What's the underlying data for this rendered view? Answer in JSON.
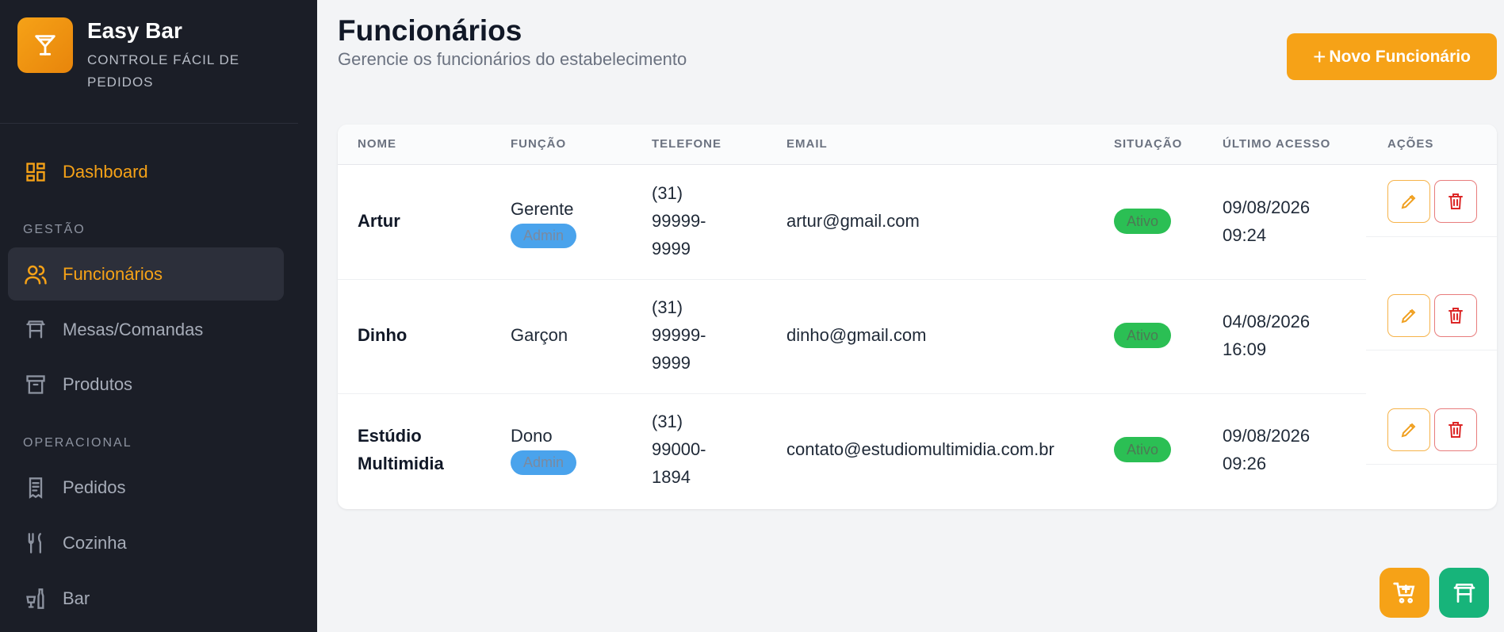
{
  "brand": {
    "title": "Easy Bar",
    "subtitle": "CONTROLE FÁCIL DE PEDIDOS"
  },
  "sidebar": {
    "dashboard": "Dashboard",
    "section_gestao": "GESTÃO",
    "funcionarios": "Funcionários",
    "mesas": "Mesas/Comandas",
    "produtos": "Produtos",
    "section_operacional": "OPERACIONAL",
    "pedidos": "Pedidos",
    "cozinha": "Cozinha",
    "bar": "Bar",
    "active_item": "Funcionários"
  },
  "header": {
    "title": "Funcionários",
    "subtitle": "Gerencie os funcionários do estabelecimento",
    "new_button": "Novo Funcionário"
  },
  "table": {
    "columns": [
      "NOME",
      "FUNÇÃO",
      "TELEFONE",
      "EMAIL",
      "SITUAÇÃO",
      "ÚLTIMO ACESSO",
      "AÇÕES"
    ],
    "rows": [
      {
        "name_l1": "Artur",
        "name_l2": "",
        "role": "Gerente",
        "badge": "Admin",
        "phone_l1": "(31)",
        "phone_l2": "99999-",
        "phone_l3": "9999",
        "email": "artur@gmail.com",
        "status": "Ativo",
        "date": "09/08/2026",
        "time": "09:24"
      },
      {
        "name_l1": "Dinho",
        "name_l2": "",
        "role": "Garçon",
        "badge": "",
        "phone_l1": "(31)",
        "phone_l2": "99999-",
        "phone_l3": "9999",
        "email": "dinho@gmail.com",
        "status": "Ativo",
        "date": "04/08/2026",
        "time": "16:09"
      },
      {
        "name_l1": "Estúdio",
        "name_l2": "Multimidia",
        "role": "Dono",
        "badge": "Admin",
        "phone_l1": "(31)",
        "phone_l2": "99000-",
        "phone_l3": "1894",
        "email": "contato@estudiomultimidia.com.br",
        "status": "Ativo",
        "date": "09/08/2026",
        "time": "09:26"
      }
    ]
  },
  "colors": {
    "accent": "#f6a217",
    "sidebar_bg": "#1b1e27",
    "status_green": "#2bbf54",
    "badge_blue": "#4aa3ec",
    "fab_green": "#17b47a",
    "delete_red": "#dc2626"
  },
  "icons": {
    "logo": "cocktail-glass-icon",
    "dashboard": "dashboard-grid-icon",
    "funcionarios": "users-icon",
    "mesas": "table-icon",
    "produtos": "archive-box-icon",
    "pedidos": "receipt-icon",
    "cozinha": "fork-knife-icon",
    "bar": "bottle-glass-icon",
    "edit": "pencil-icon",
    "delete": "trash-icon",
    "fab_cart": "cart-plus-icon",
    "fab_table": "table-icon"
  }
}
